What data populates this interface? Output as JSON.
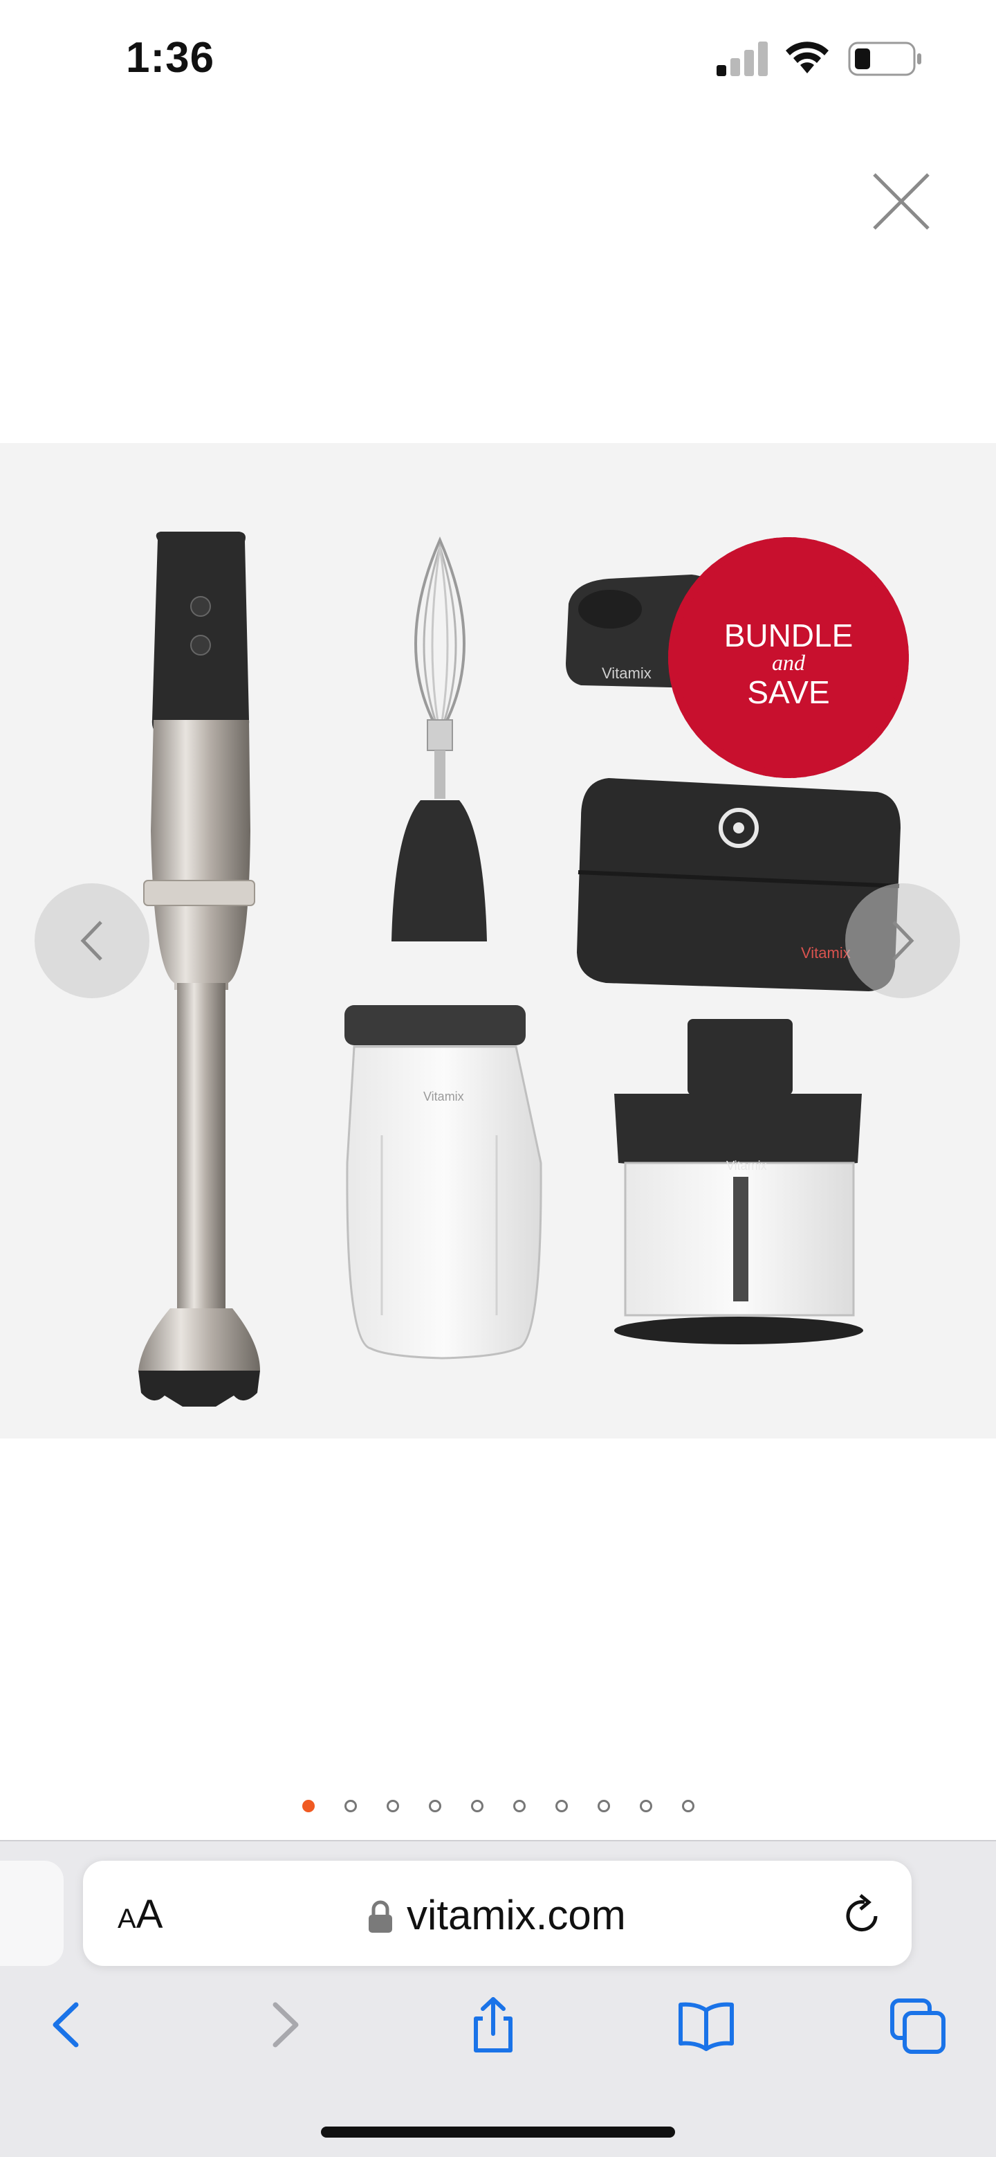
{
  "status_bar": {
    "time": "1:36",
    "icons": [
      "cellular-signal-icon",
      "wifi-icon",
      "battery-icon"
    ]
  },
  "gallery": {
    "badge": {
      "line1": "BUNDLE",
      "line2": "and",
      "line3": "SAVE"
    },
    "brand_marks": [
      "Vitamix",
      "Vitamix",
      "Vitamix",
      "Vitamix"
    ],
    "dots_count": 10,
    "active_dot": 0,
    "colors": {
      "background": "#f3f3f3",
      "badge_red": "#c8102e",
      "active_dot": "#f05a22"
    }
  },
  "browser": {
    "text_size_label_small": "A",
    "text_size_label_large": "A",
    "url": "vitamix.com",
    "accent": "#1a73e8"
  }
}
